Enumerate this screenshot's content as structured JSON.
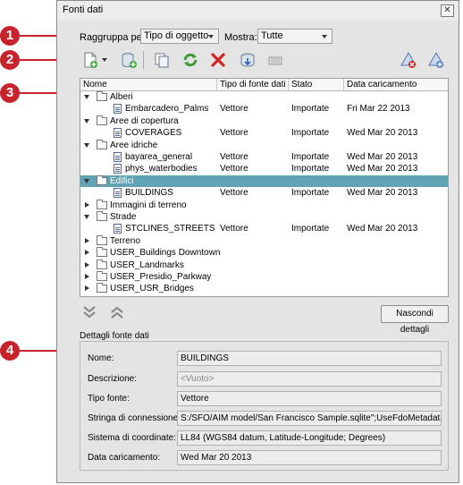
{
  "window": {
    "title": "Fonti dati",
    "close_glyph": "✕"
  },
  "callouts": [
    "1",
    "2",
    "3",
    "4"
  ],
  "group_by": {
    "label": "Raggruppa per:",
    "value": "Tipo di oggetto"
  },
  "show": {
    "label": "Mostra:",
    "value": "Tutte"
  },
  "toolbar": {
    "icons": [
      "new-connection-icon",
      "add-data-icon",
      "copy-icon",
      "refresh-icon",
      "delete-icon",
      "import-icon",
      "properties-icon",
      "layer-off-icon",
      "layer-on-icon"
    ]
  },
  "tree": {
    "headers": [
      "Nome",
      "Tipo di fonte dati",
      "Stato",
      "Data caricamento"
    ],
    "rows": [
      {
        "kind": "group",
        "open": true,
        "name": "Alberi"
      },
      {
        "kind": "item",
        "name": "Embarcadero_Palms",
        "type": "Vettore",
        "state": "Importate",
        "date": "Fri Mar 22 2013"
      },
      {
        "kind": "group",
        "open": true,
        "name": "Aree di copertura"
      },
      {
        "kind": "item",
        "name": "COVERAGES",
        "type": "Vettore",
        "state": "Importate",
        "date": "Wed Mar 20 2013"
      },
      {
        "kind": "group",
        "open": true,
        "name": "Aree idriche"
      },
      {
        "kind": "item",
        "name": "bayarea_general",
        "type": "Vettore",
        "state": "Importate",
        "date": "Wed Mar 20 2013"
      },
      {
        "kind": "item",
        "name": "phys_waterbodies",
        "type": "Vettore",
        "state": "Importate",
        "date": "Wed Mar 20 2013"
      },
      {
        "kind": "group",
        "open": true,
        "name": "Edifici",
        "selected": true
      },
      {
        "kind": "item",
        "name": "BUILDINGS",
        "type": "Vettore",
        "state": "Importate",
        "date": "Wed Mar 20 2013"
      },
      {
        "kind": "group",
        "open": false,
        "name": "Immagini di terreno"
      },
      {
        "kind": "group",
        "open": true,
        "name": "Strade"
      },
      {
        "kind": "item",
        "name": "STCLINES_STREETS",
        "type": "Vettore",
        "state": "Importate",
        "date": "Wed Mar 20 2013"
      },
      {
        "kind": "group",
        "open": false,
        "name": "Terreno"
      },
      {
        "kind": "group",
        "open": false,
        "name": "USER_Buildings Downtown"
      },
      {
        "kind": "group",
        "open": false,
        "name": "USER_Landmarks"
      },
      {
        "kind": "group",
        "open": false,
        "name": "USER_Presidio_Parkway"
      },
      {
        "kind": "group",
        "open": false,
        "name": "USER_USR_Bridges"
      }
    ]
  },
  "hide_details": {
    "label": "Nascondi dettagli"
  },
  "details": {
    "title": "Dettagli fonte dati",
    "fields": [
      {
        "label": "Nome:",
        "value": "BUILDINGS"
      },
      {
        "label": "Descrizione:",
        "value": "<Vuoto>"
      },
      {
        "label": "Tipo fonte:",
        "value": "Vettore"
      },
      {
        "label": "Stringa di connessione:",
        "value": "S:/SFO/AIM model/San Francisco Sample.sqlite\";UseFdoMetadata=TRUE"
      },
      {
        "label": "Sistema di coordinate:",
        "value": "LL84 (WGS84 datum, Latitude-Longitude; Degrees)"
      },
      {
        "label": "Data caricamento:",
        "value": "Wed Mar 20 2013"
      }
    ]
  },
  "colors": {
    "callout": "#c8232c",
    "selection": "#5fa3b4"
  }
}
